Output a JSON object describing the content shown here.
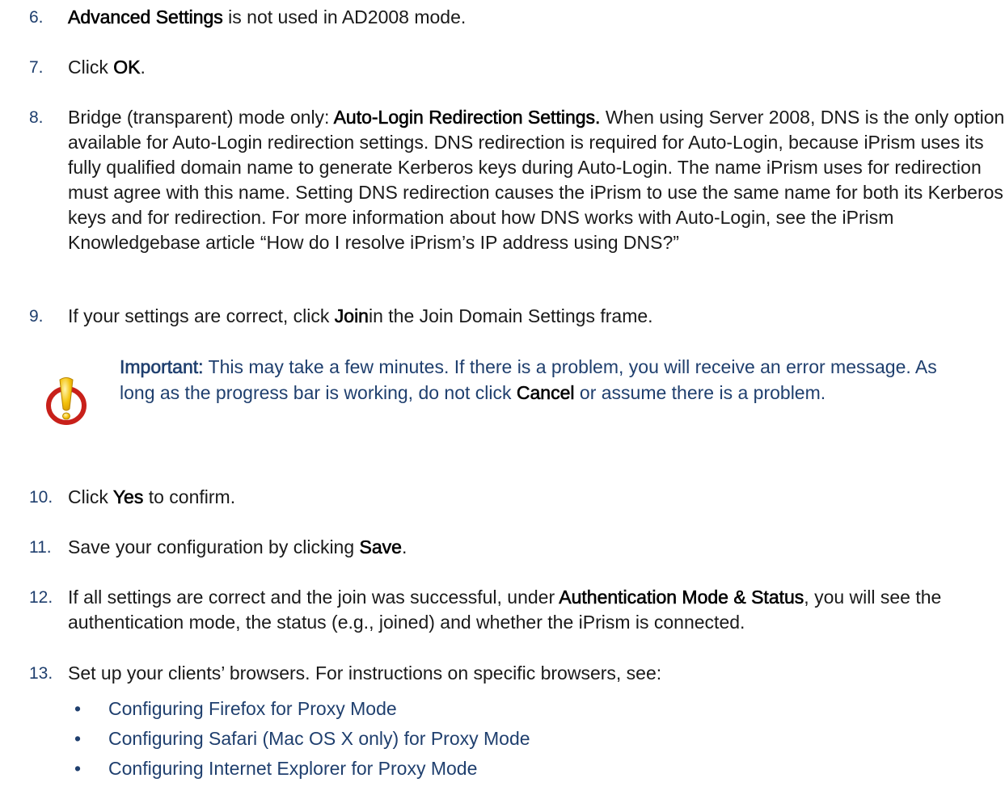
{
  "steps": [
    {
      "number": "6.",
      "parts": [
        {
          "text": "Advanced Settings",
          "bold": true
        },
        {
          "text": " is not used in AD2008 mode.",
          "bold": false
        }
      ]
    },
    {
      "number": "7.",
      "parts": [
        {
          "text": "Click ",
          "bold": false
        },
        {
          "text": "OK",
          "bold": true
        },
        {
          "text": ".",
          "bold": false
        }
      ]
    },
    {
      "number": "8.",
      "parts": [
        {
          "text": "Bridge (transparent) mode only: ",
          "bold": false
        },
        {
          "text": "Auto-Login Redirection Settings.",
          "bold": true
        },
        {
          "text": " When using Server 2008, DNS is the only option available for Auto-Login redirection settings. DNS redirection is required for Auto-Login, because iPrism uses its fully qualified domain name to generate Kerberos keys during Auto-Login. The name iPrism uses for redirection must agree with this name. Setting DNS redirection causes the iPrism to use the same name for both its Kerberos keys and for redirection. For more information about how DNS works with Auto-Login, see the iPrism Knowledgebase article “How do I resolve iPrism’s IP address using DNS?”",
          "bold": false
        }
      ]
    },
    {
      "number": "9.",
      "parts": [
        {
          "text": "If your settings are correct, click ",
          "bold": false
        },
        {
          "text": "Join",
          "bold": true
        },
        {
          "text": "in the Join Domain Settings frame.",
          "bold": false
        }
      ]
    },
    {
      "number": "10.",
      "parts": [
        {
          "text": "Click ",
          "bold": false
        },
        {
          "text": "Yes",
          "bold": true
        },
        {
          "text": " to confirm.",
          "bold": false
        }
      ]
    },
    {
      "number": "11.",
      "parts": [
        {
          "text": "Save your configuration by clicking ",
          "bold": false
        },
        {
          "text": "Save",
          "bold": true
        },
        {
          "text": ".",
          "bold": false
        }
      ]
    },
    {
      "number": "12.",
      "parts": [
        {
          "text": "If all settings are correct and the join was successful, under ",
          "bold": false
        },
        {
          "text": "Authentication Mode & Status",
          "bold": true
        },
        {
          "text": ", you will see the authentication mode, the status (e.g., joined) and whether the iPrism is connected.",
          "bold": false
        }
      ]
    },
    {
      "number": "13.",
      "parts": [
        {
          "text": "Set up your clients’ browsers. For instructions on specific browsers, see:",
          "bold": false
        }
      ]
    }
  ],
  "important_note": {
    "label": "Important:",
    "text_1": " This may take a few minutes. If there is a problem, you will receive an error message. As long as the progress bar is working, do not click ",
    "cancel": "Cancel",
    "text_2": " or assume there is a problem.",
    "icon": "warning-icon"
  },
  "browser_links": [
    {
      "bullet": "•",
      "label": "Configuring Firefox for Proxy Mode"
    },
    {
      "bullet": "•",
      "label": "Configuring Safari (Mac OS X only) for Proxy Mode"
    },
    {
      "bullet": "•",
      "label": "Configuring Internet Explorer for Proxy Mode"
    }
  ],
  "colors": {
    "number_color": "#1f3f6e",
    "link_color": "#1f3f6e",
    "body_text": "#1a1a1a",
    "warning_red": "#c8201a",
    "warning_yellow": "#f4c20d"
  }
}
